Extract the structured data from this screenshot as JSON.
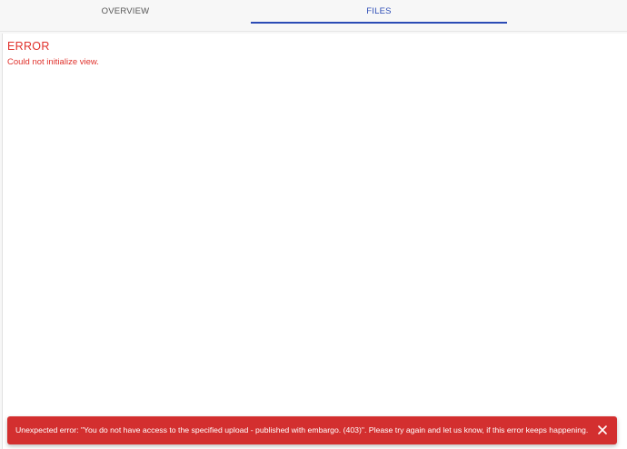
{
  "tabs": [
    {
      "label": "OVERVIEW",
      "active": false
    },
    {
      "label": "FILES",
      "active": true
    }
  ],
  "error": {
    "title": "ERROR",
    "message": "Could not initialize view."
  },
  "snackbar": {
    "message": "Unexpected error: \"You do not have access to the specified upload - published with embargo. (403)\". Please try again and let us know, if this error keeps happening.",
    "close_icon": "close-icon"
  },
  "colors": {
    "accent": "#2b4bb5",
    "error": "#e0312b",
    "snackbar_bg": "#d32f2f"
  }
}
